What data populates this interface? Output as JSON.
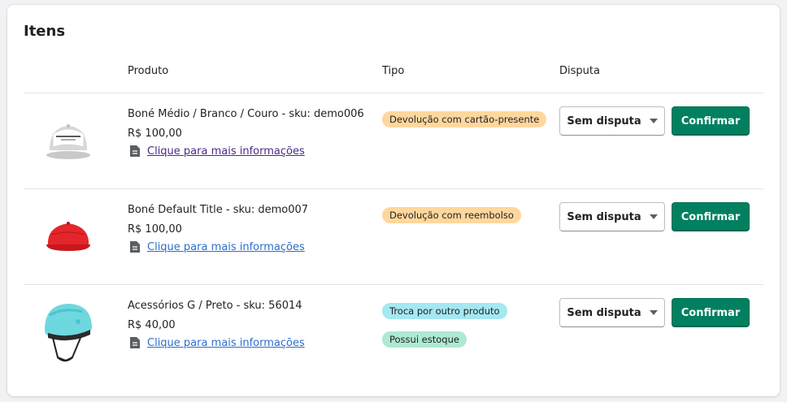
{
  "section": {
    "title": "Itens"
  },
  "columns": {
    "product": "Produto",
    "type": "Tipo",
    "dispute": "Disputa"
  },
  "items": [
    {
      "name": "Boné Médio / Branco / Couro - sku: demo006",
      "price": "R$ 100,00",
      "more_info": "Clique para mais informações",
      "more_info_visited": true,
      "thumbnail": "white-cap",
      "badges": [
        {
          "label": "Devolução com cartão-presente",
          "color": "#ffd79d"
        }
      ],
      "dispute_value": "Sem disputa",
      "confirm_label": "Confirmar"
    },
    {
      "name": "Boné Default Title - sku: demo007",
      "price": "R$ 100,00",
      "more_info": "Clique para mais informações",
      "more_info_visited": false,
      "thumbnail": "red-cap",
      "badges": [
        {
          "label": "Devolução com reembolso",
          "color": "#ffd79d"
        }
      ],
      "dispute_value": "Sem disputa",
      "confirm_label": "Confirmar"
    },
    {
      "name": "Acessórios G / Preto - sku: 56014",
      "price": "R$ 40,00",
      "more_info": "Clique para mais informações",
      "more_info_visited": false,
      "thumbnail": "teal-helmet",
      "badges": [
        {
          "label": "Troca por outro produto",
          "color": "#a4e8f2"
        },
        {
          "label": "Possui estoque",
          "color": "#aee9d1"
        }
      ],
      "dispute_value": "Sem disputa",
      "confirm_label": "Confirmar"
    }
  ],
  "colors": {
    "primary_button": "#008060",
    "link": "#2c6ecb",
    "link_visited": "#4b2a87"
  },
  "icons": {
    "document": "document-icon",
    "caret": "caret-down-icon"
  }
}
